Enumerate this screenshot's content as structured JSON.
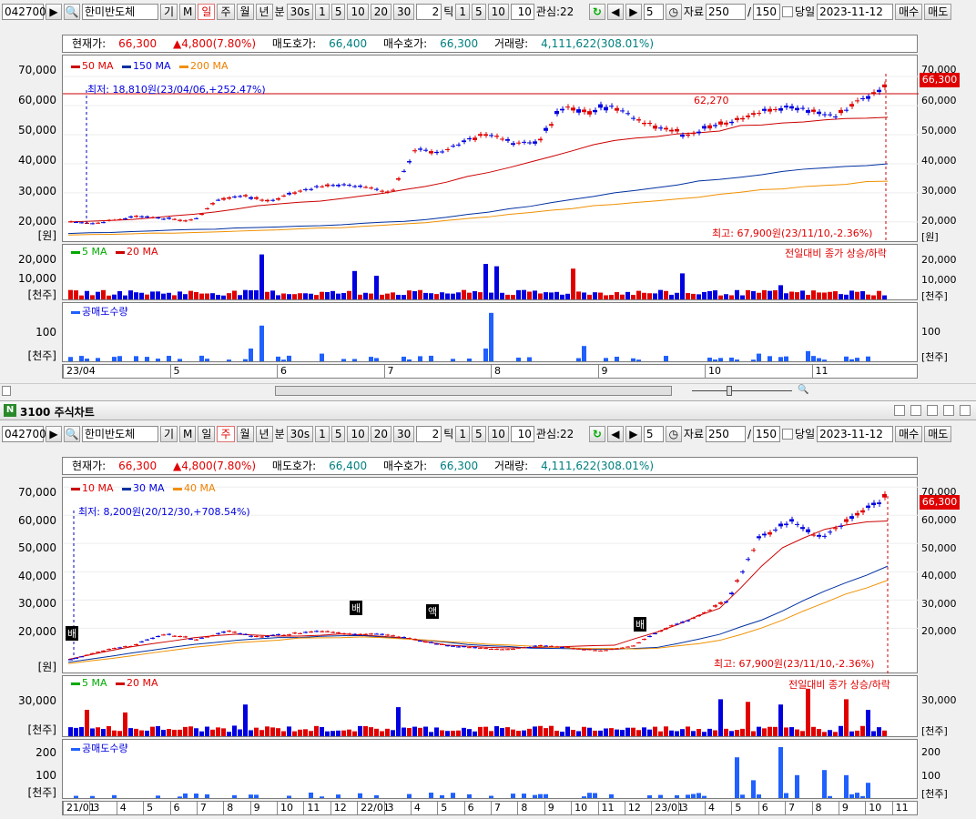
{
  "toolbar": {
    "code": "042700",
    "name": "한미반도체",
    "mode_gi": "기",
    "mode_m": "M",
    "periods": [
      "일",
      "주",
      "월",
      "년"
    ],
    "minute_label": "분",
    "sec_label": "30s",
    "minutes": [
      "1",
      "5",
      "10",
      "20",
      "30"
    ],
    "tick_count": "2",
    "tick_label": "틱",
    "tick_opts": [
      "1",
      "5",
      "10"
    ],
    "tick_value": "10",
    "watch": "관심:22",
    "step": "5",
    "data_label": "자료",
    "data_count": "250",
    "slash": "/",
    "data_max": "150",
    "today_label": "당일",
    "date": "2023-11-12",
    "buy": "매수",
    "sell": "매도"
  },
  "toolbar2": {
    "code": "042700",
    "name": "한미반도체",
    "mode_gi": "기",
    "mode_m": "M",
    "periods": [
      "일",
      "주",
      "월",
      "년"
    ],
    "minute_label": "분",
    "sec_label": "30s",
    "minutes": [
      "1",
      "5",
      "10",
      "20",
      "30"
    ],
    "tick_count": "2",
    "tick_label": "틱",
    "tick_opts": [
      "1",
      "5",
      "10"
    ],
    "tick_value": "10",
    "watch": "관심:22",
    "step": "5",
    "data_label": "자료",
    "data_count": "250",
    "slash": "/",
    "data_max": "150",
    "today_label": "당일",
    "date": "2023-11-12",
    "buy": "매수",
    "sell": "매도"
  },
  "window": {
    "title": "3100 주식차트"
  },
  "quote": {
    "cur_label": "현재가:",
    "cur": "66,300",
    "chg": "▲4,800(7.80%)",
    "ask_label": "매도호가:",
    "ask": "66,400",
    "bid_label": "매수호가:",
    "bid": "66,300",
    "vol_label": "거래량:",
    "vol": "4,111,622(308.01%)"
  },
  "chart1": {
    "ma": [
      "50 MA",
      "150 MA",
      "200 MA"
    ],
    "low_note": "최저: 18,810원(23/04/06,+252.47%)",
    "high_note": "최고: 67,900원(23/11/10,-2.36%)",
    "line_label": "62,270",
    "price_badge": "66,300",
    "yticks": [
      "70,000",
      "60,000",
      "50,000",
      "40,000",
      "30,000",
      "20,000"
    ],
    "unit": "[원]",
    "vol_ma": [
      "5 MA",
      "20 MA"
    ],
    "vol_note": "전일대비 종가 상승/하락",
    "vol_ticks": [
      "20,000",
      "10,000"
    ],
    "vol_unit": "[천주]",
    "short_label": "공매도수량",
    "short_ticks": [
      "100"
    ],
    "short_unit": "[천주]",
    "xlabels": [
      "23/04",
      "5",
      "6",
      "7",
      "8",
      "9",
      "10",
      "11"
    ]
  },
  "chart2": {
    "ma": [
      "10 MA",
      "30 MA",
      "40 MA"
    ],
    "low_note": "최저: 8,200원(20/12/30,+708.54%)",
    "high_note": "최고: 67,900원(23/11/10,-2.36%)",
    "price_badge": "66,300",
    "yticks": [
      "70,000",
      "60,000",
      "50,000",
      "40,000",
      "30,000",
      "20,000"
    ],
    "unit": "[원]",
    "vol_ma": [
      "5 MA",
      "20 MA"
    ],
    "vol_note": "전일대비 종가 상승/하락",
    "vol_ticks": [
      "30,000"
    ],
    "vol_unit": "[천주]",
    "short_label": "공매도수량",
    "short_ticks": [
      "200",
      "100"
    ],
    "short_unit": "[천주]",
    "markers": [
      "배",
      "배",
      "액",
      "배"
    ],
    "xlabels": [
      "21/01",
      "3",
      "4",
      "5",
      "6",
      "7",
      "8",
      "9",
      "10",
      "11",
      "12",
      "22/01",
      "3",
      "4",
      "5",
      "6",
      "7",
      "8",
      "9",
      "10",
      "11",
      "12",
      "23/01",
      "3",
      "4",
      "5",
      "6",
      "7",
      "8",
      "9",
      "10",
      "11"
    ]
  },
  "colors": {
    "up": "#e00000",
    "down": "#0000e0",
    "ma1": "#cc0000",
    "ma2": "#0030a0",
    "ma3": "#f09000"
  }
}
